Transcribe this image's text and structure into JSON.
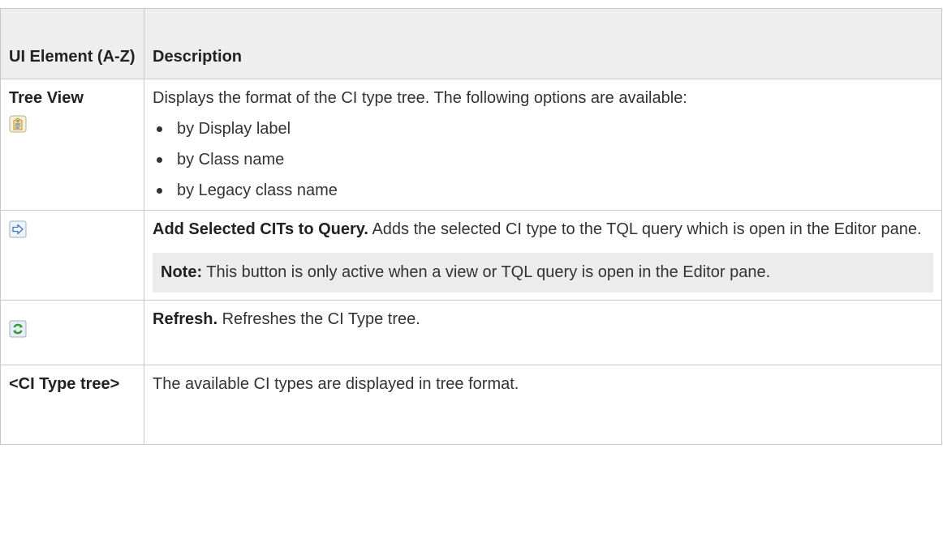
{
  "table": {
    "header": {
      "col1": "UI Element (A-Z)",
      "col2": "Description"
    },
    "rows": [
      {
        "element": "Tree View",
        "icon": "tag-label-icon",
        "description": "Displays the format of the CI type tree. The following options are available:",
        "options": [
          "by Display label",
          "by Class name",
          "by Legacy class name"
        ]
      },
      {
        "icon": "arrow-right-icon",
        "title": "Add Selected CITs to Query.",
        "description": " Adds the selected CI type to the TQL query which is open in the Editor pane.",
        "note_label": "Note:",
        "note_text": " This button is only active when a view or TQL query is open in the Editor pane."
      },
      {
        "icon": "refresh-icon",
        "title": "Refresh.",
        "description": " Refreshes the CI Type tree."
      },
      {
        "element": "<CI Type tree>",
        "description": "The available CI types are displayed in tree format."
      }
    ]
  },
  "colors": {
    "header_bg": "#eeeeee",
    "note_bg": "#ececec",
    "border": "#c8c8c8",
    "text": "#333333"
  }
}
